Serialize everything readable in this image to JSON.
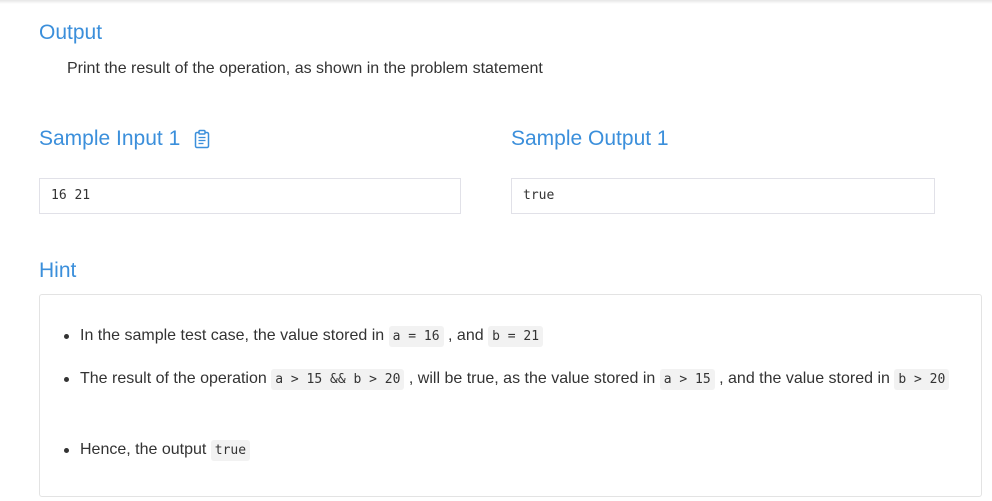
{
  "output": {
    "heading": "Output",
    "description": "Print the result of the operation, as shown in the problem statement"
  },
  "sample_input": {
    "heading": "Sample Input 1",
    "copy_icon": "clipboard-icon",
    "value": "16 21"
  },
  "sample_output": {
    "heading": "Sample Output 1",
    "value": "true"
  },
  "hint": {
    "heading": "Hint",
    "items": [
      {
        "t1": "In the sample test case, the value stored in ",
        "c1": "a = 16",
        "t2": " , and ",
        "c2": "b = 21"
      },
      {
        "t1": "The result of the operation ",
        "c1": "a > 15 && b > 20",
        "t2": " , will be true, as the value stored in ",
        "c2": "a > 15",
        "t3": " , and the value stored in ",
        "c3": "b > 20"
      },
      {
        "t1": "Hence, the output ",
        "c1": "true"
      }
    ]
  },
  "colors": {
    "heading": "#3b8fdb",
    "text": "#333333",
    "code_bg": "#f2f2f2",
    "border": "#e1e1e8"
  }
}
